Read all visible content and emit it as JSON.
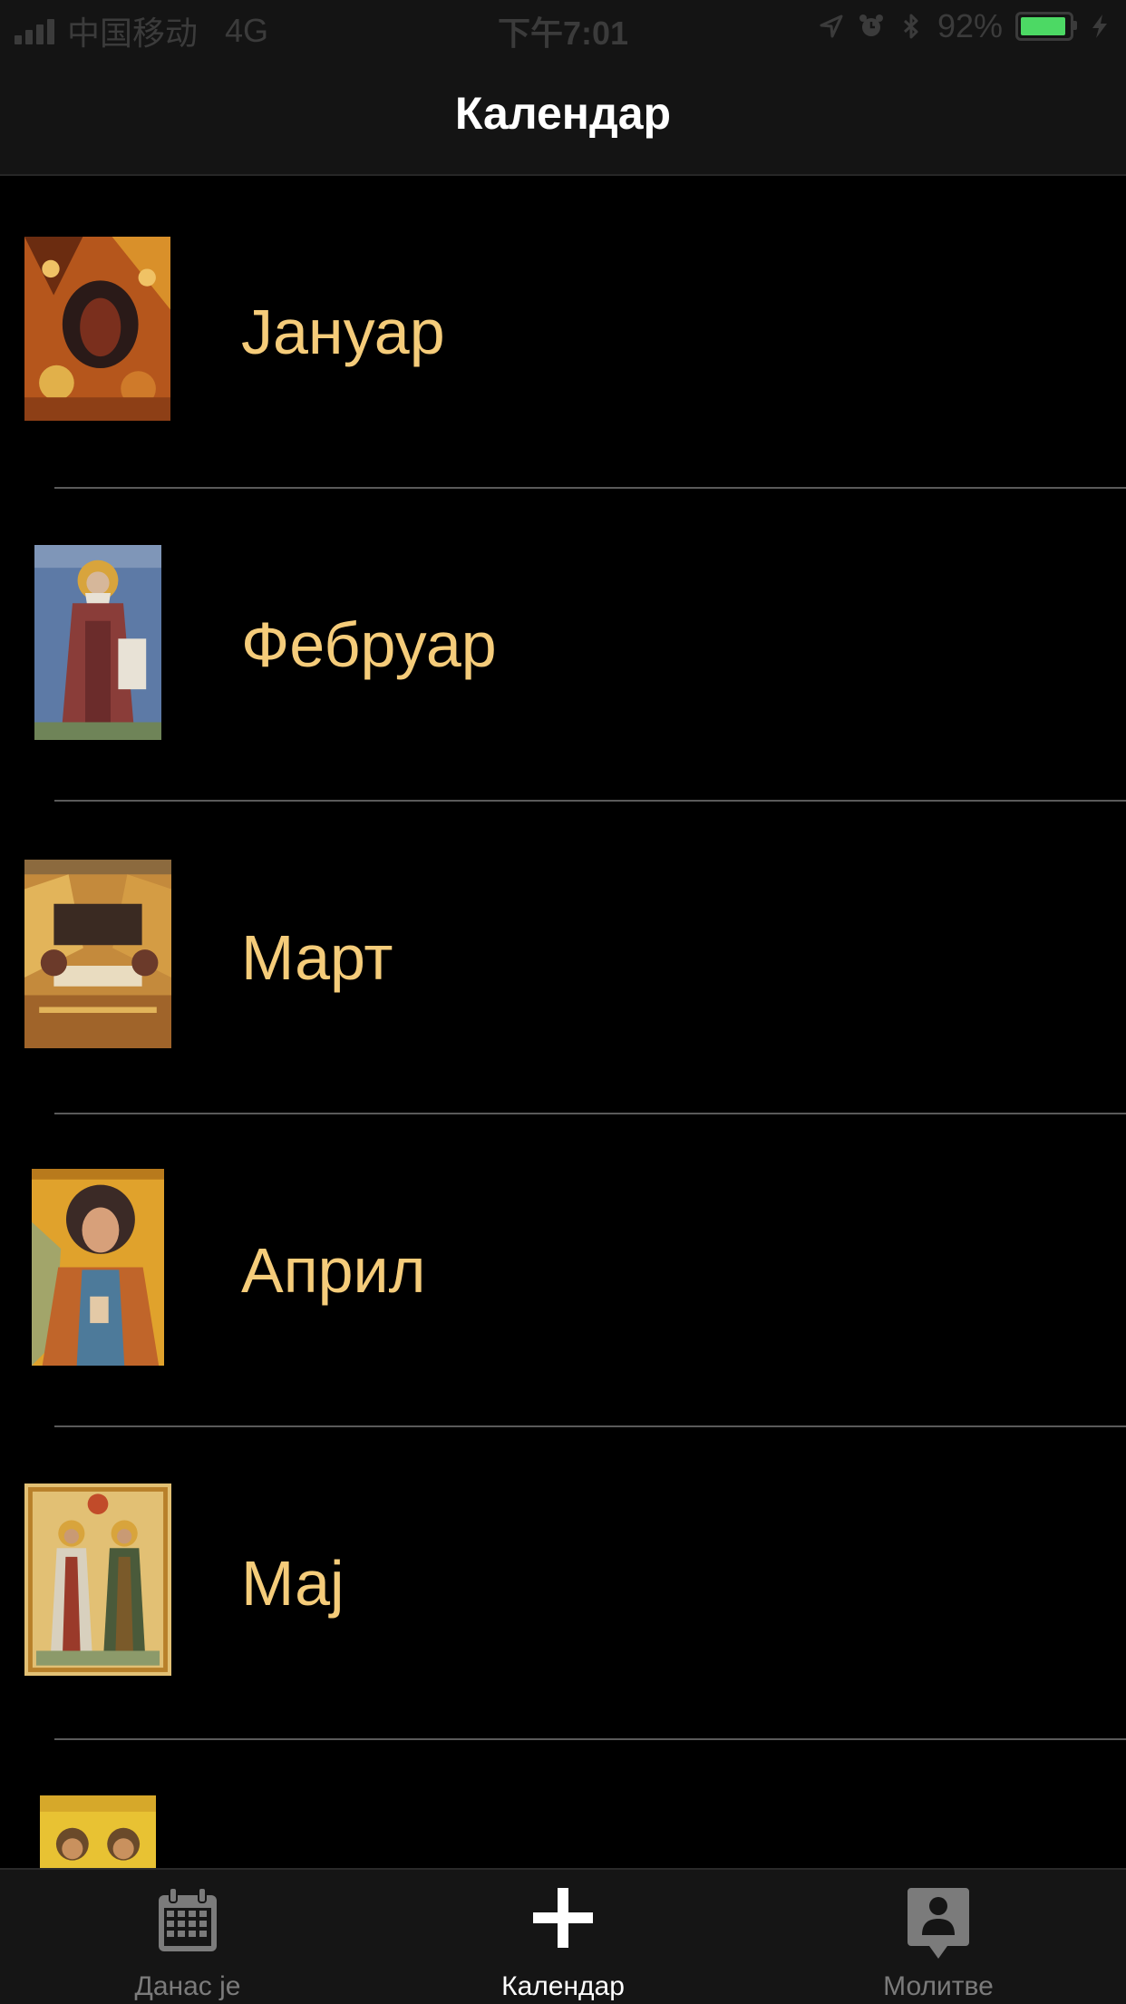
{
  "status_bar": {
    "carrier": "中国移动",
    "network": "4G",
    "time": "下午7:01",
    "battery_percent": "92%",
    "battery_level": 0.92,
    "battery_color": "#4cd964"
  },
  "nav": {
    "title": "Календар"
  },
  "months": [
    {
      "label": "Јануар",
      "icon": "nativity-icon-thumbnail"
    },
    {
      "label": "Фебруар",
      "icon": "saint-icon-thumbnail"
    },
    {
      "label": "Март",
      "icon": "entombment-icon-thumbnail"
    },
    {
      "label": "Април",
      "icon": "archangel-icon-thumbnail"
    },
    {
      "label": "Мај",
      "icon": "two-saints-icon-thumbnail"
    },
    {
      "label": "",
      "icon": "apostles-icon-thumbnail"
    }
  ],
  "tab_bar": {
    "tabs": [
      {
        "label": "Данас је",
        "icon": "calendar-icon",
        "active": false
      },
      {
        "label": "Календар",
        "icon": "cross-icon",
        "active": true
      },
      {
        "label": "Молитве",
        "icon": "person-pin-icon",
        "active": false
      }
    ]
  },
  "colors": {
    "month_label": "#f5cc7a",
    "background": "#000000",
    "bar_background": "#141414"
  }
}
